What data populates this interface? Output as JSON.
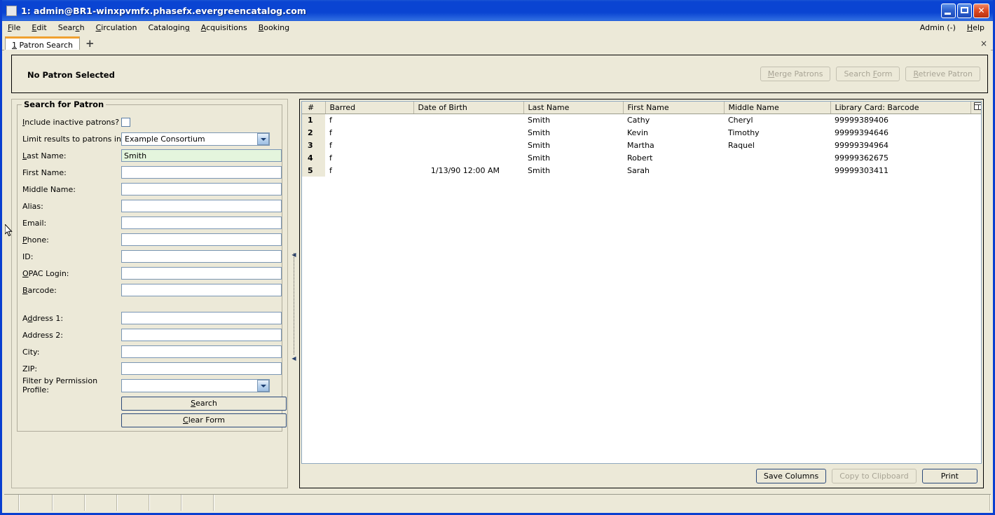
{
  "window": {
    "title": "1: admin@BR1-winxpvmfx.phasefx.evergreencatalog.com",
    "minimize_label": "Minimize",
    "maximize_label": "Maximize",
    "close_label": "Close"
  },
  "menubar": {
    "items": [
      {
        "label": "File",
        "accesskey": "F"
      },
      {
        "label": "Edit",
        "accesskey": "E"
      },
      {
        "label": "Search",
        "accesskey": "c"
      },
      {
        "label": "Circulation",
        "accesskey": "C"
      },
      {
        "label": "Cataloging",
        "accesskey": "g"
      },
      {
        "label": "Acquisitions",
        "accesskey": "A"
      },
      {
        "label": "Booking",
        "accesskey": "B"
      }
    ],
    "right": [
      {
        "label": "Admin (-)"
      },
      {
        "label": "Help",
        "accesskey": "H"
      }
    ]
  },
  "tabs": {
    "items": [
      {
        "number": "1",
        "label": "Patron Search"
      }
    ],
    "add_label": "+",
    "close_all_label": "×"
  },
  "patron_header": {
    "status": "No Patron Selected",
    "buttons": [
      {
        "label": "Merge Patrons",
        "enabled": false
      },
      {
        "label": "Search Form",
        "enabled": false
      },
      {
        "label": "Retrieve Patron",
        "enabled": false
      }
    ]
  },
  "search_form": {
    "legend": "Search for Patron",
    "include_inactive": {
      "label": "Include inactive patrons?",
      "checked": false
    },
    "limit_results": {
      "label": "Limit results to patrons in",
      "value": "Example Consortium"
    },
    "fields": [
      {
        "label": "Last Name:",
        "value": "Smith",
        "focused": true
      },
      {
        "label": "First Name:",
        "value": ""
      },
      {
        "label": "Middle Name:",
        "value": ""
      },
      {
        "label": "Alias:",
        "value": ""
      },
      {
        "label": "Email:",
        "value": ""
      },
      {
        "label": "Phone:",
        "value": ""
      },
      {
        "label": "ID:",
        "value": ""
      },
      {
        "label": "OPAC Login:",
        "value": ""
      },
      {
        "label": "Barcode:",
        "value": ""
      }
    ],
    "address_fields": [
      {
        "label": "Address 1:",
        "value": ""
      },
      {
        "label": "Address 2:",
        "value": ""
      },
      {
        "label": "City:",
        "value": ""
      },
      {
        "label": "ZIP:",
        "value": ""
      }
    ],
    "permission_profile": {
      "label": "Filter by Permission Profile:",
      "value": ""
    },
    "search_button": "Search",
    "clear_button": "Clear Form"
  },
  "results": {
    "columns": [
      "#",
      "Barred",
      "Date of Birth",
      "Last Name",
      "First Name",
      "Middle Name",
      "Library Card: Barcode"
    ],
    "column_picker_icon": "column-picker-icon",
    "rows": [
      {
        "num": "1",
        "barred": "f",
        "dob": "",
        "last": "Smith",
        "first": "Cathy",
        "middle": "Cheryl",
        "barcode": "99999389406"
      },
      {
        "num": "2",
        "barred": "f",
        "dob": "",
        "last": "Smith",
        "first": "Kevin",
        "middle": "Timothy",
        "barcode": "99999394646"
      },
      {
        "num": "3",
        "barred": "f",
        "dob": "",
        "last": "Smith",
        "first": "Martha",
        "middle": "Raquel",
        "barcode": "99999394964"
      },
      {
        "num": "4",
        "barred": "f",
        "dob": "",
        "last": "Smith",
        "first": "Robert",
        "middle": "",
        "barcode": "99999362675"
      },
      {
        "num": "5",
        "barred": "f",
        "dob": "1/13/90 12:00 AM",
        "last": "Smith",
        "first": "Sarah",
        "middle": "",
        "barcode": "99999303411"
      }
    ],
    "footer_buttons": [
      {
        "label": "Save Columns",
        "enabled": true
      },
      {
        "label": "Copy to Clipboard",
        "enabled": false
      },
      {
        "label": "Print",
        "enabled": true
      }
    ]
  },
  "colors": {
    "titlebar_blue": "#0a44d2",
    "window_beige": "#ece9d8",
    "tab_accent": "#f0a030",
    "focused_field": "#e4f5dd",
    "close_red": "#df4c24"
  }
}
